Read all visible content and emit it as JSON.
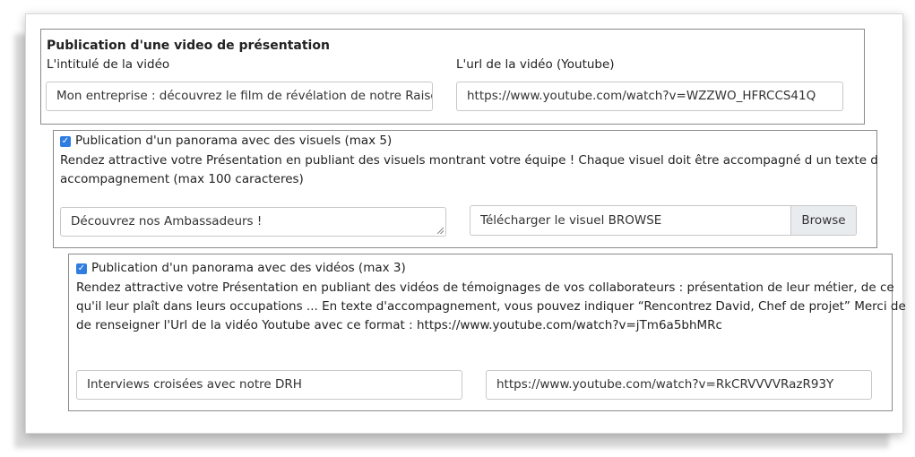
{
  "video_section": {
    "title": "Publication d'une video de présentation",
    "title_label": "L'intitulé de la vidéo",
    "title_value": "Mon entreprise : découvrez le film de révélation de notre Raiso",
    "url_label": "L'url de la vidéo (Youtube)",
    "url_value": "https://www.youtube.com/watch?v=WZZWO_HFRCCS41Q"
  },
  "visuals_section": {
    "checkbox_checked": true,
    "checkbox_label": "Publication d'un panorama avec des visuels (max 5)",
    "description_line1": "Rendez attractive votre Présentation en publiant des visuels montrant votre équipe ! Chaque visuel doit être accompagné d un texte d",
    "description_line2": "accompagnement (max 100 caracteres)",
    "caption_value": "Découvrez nos Ambassadeurs !",
    "upload_label": "Télécharger le visuel BROWSE",
    "browse_label": "Browse"
  },
  "videos_section": {
    "checkbox_checked": true,
    "checkbox_label": "Publication d'un panorama avec des vidéos (max 3)",
    "description_line1": "Rendez attractive votre Présentation en publiant des vidéos de témoignages de vos collaborateurs : présentation de leur métier, de ce",
    "description_line2": "qu'il leur plaît dans leurs occupations ... En texte d'accompagnement, vous pouvez indiquer “Rencontrez David, Chef de projet” Merci de",
    "description_line3": "de renseigner l'Url de la vidéo Youtube avec ce format : https://www.youtube.com/watch?v=jTm6a5bhMRc",
    "caption_value": "Interviews croisées avec notre DRH",
    "url_value": "https://www.youtube.com/watch?v=RkCRVVVVRazR93Y"
  },
  "colors": {
    "checkbox": "#2f7de1",
    "border": "#8a8a8a",
    "button_bg": "#e9ecef"
  }
}
